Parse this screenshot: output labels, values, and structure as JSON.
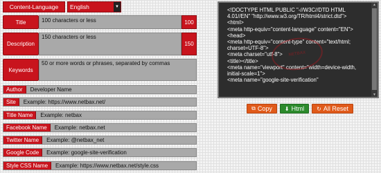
{
  "language": {
    "label": "Content-Language",
    "selected": "English"
  },
  "title_field": {
    "label": "Title",
    "value": "100 characters or less",
    "counter": "100"
  },
  "description_field": {
    "label": "Description",
    "value": "150 characters or less",
    "counter": "150"
  },
  "keywords_field": {
    "label": "Keywords",
    "value": "50 or more words or phrases, separated by commas"
  },
  "rows": [
    {
      "label": "Author",
      "value": "Developer Name"
    },
    {
      "label": "Site",
      "value": "Example:    https://www.netbax.net/"
    },
    {
      "label": "Title Name",
      "value": "Example:      netbax"
    },
    {
      "label": "Facebook Name",
      "value": "Example:      netbax.net"
    },
    {
      "label": "Twitter Name",
      "value": "Example:      @netbax_net"
    },
    {
      "label": "Google Code",
      "value": "Example:      google-site-verification"
    },
    {
      "label": "Style CSS Name",
      "value": "Example:      https://www.netbax.net/style.css"
    }
  ],
  "code_output": "<!DOCTYPE HTML PUBLIC \"-//W3C//DTD HTML 4.01//EN\" \"http://www.w3.org/TR/html4/strict.dtd\">\n<html>\n<meta http-equiv=\"content-language\" content=\"EN\">\n<head>\n<meta http-equiv=\"content-type\" content=\"text/html; charset=UTF-8\">\n<meta charset=\"utf-8\">\n<title></title>\n<meta name=\"viewport\" content=\"width=device-width, initial-scale=1\">\n<meta name=\"google-site-verification\"",
  "buttons": {
    "copy": "Copy",
    "html": "Html",
    "reset": "All Reset"
  },
  "colors": {
    "accent_red": "#c8141d",
    "field_gray": "#a9a9a9",
    "code_bg": "#2d2d2d",
    "orange": "#e05a1a",
    "green": "#2c8a2c"
  },
  "icons": {
    "copy": "copy-icon",
    "html": "download-icon",
    "reset": "reset-icon"
  }
}
